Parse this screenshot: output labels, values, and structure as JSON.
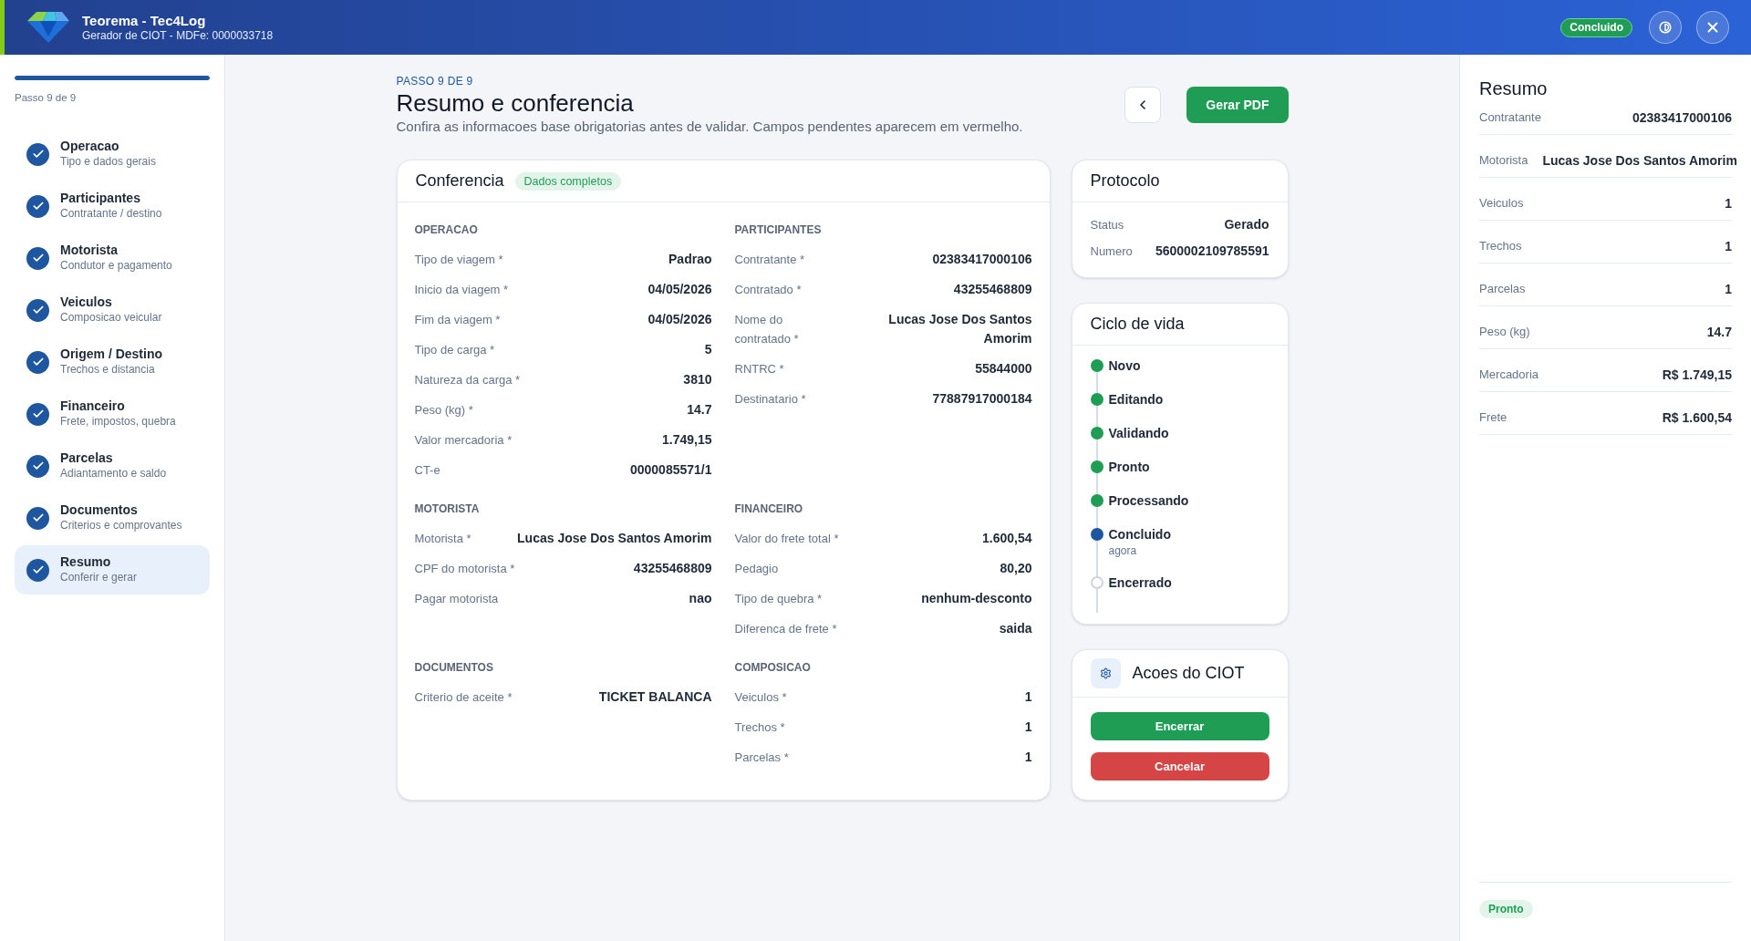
{
  "header": {
    "title": "Teorema - Tec4Log",
    "subtitle": "Gerador de CIOT - MDFe: 0000033718",
    "status": "Concluido"
  },
  "sidebar": {
    "progress": {
      "level": 1
    },
    "progress_label": "Passo 9 de 9",
    "steps": [
      {
        "title": "Operacao",
        "subtitle": "Tipo e dados gerais",
        "done": true,
        "selected": false
      },
      {
        "title": "Participantes",
        "subtitle": "Contratante / destino",
        "done": true,
        "selected": false
      },
      {
        "title": "Motorista",
        "subtitle": "Condutor e pagamento",
        "done": true,
        "selected": false
      },
      {
        "title": "Veiculos",
        "subtitle": "Composicao veicular",
        "done": true,
        "selected": false
      },
      {
        "title": "Origem / Destino",
        "subtitle": "Trechos e distancia",
        "done": true,
        "selected": false
      },
      {
        "title": "Financeiro",
        "subtitle": "Frete, impostos, quebra",
        "done": true,
        "selected": false
      },
      {
        "title": "Parcelas",
        "subtitle": "Adiantamento e saldo",
        "done": true,
        "selected": false
      },
      {
        "title": "Documentos",
        "subtitle": "Criterios e comprovantes",
        "done": true,
        "selected": false
      },
      {
        "title": "Resumo",
        "subtitle": "Conferir e gerar",
        "done": true,
        "selected": true
      }
    ]
  },
  "page": {
    "eyebrow": "PASSO 9 DE 9",
    "title": "Resumo e conferencia",
    "description": "Confira as informacoes base obrigatorias antes de validar. Campos pendentes aparecem em vermelho.",
    "primary_button": "Gerar PDF"
  },
  "conferencia": {
    "title": "Conferencia",
    "badge": "Dados completos",
    "sections": [
      {
        "title": "OPERACAO",
        "rows": [
          {
            "label": "Tipo de viagem *",
            "value": "Padrao"
          },
          {
            "label": "Inicio da viagem *",
            "value": "04/05/2026"
          },
          {
            "label": "Fim da viagem *",
            "value": "04/05/2026"
          },
          {
            "label": "Tipo de carga *",
            "value": "5"
          },
          {
            "label": "Natureza da carga *",
            "value": "3810"
          },
          {
            "label": "Peso (kg) *",
            "value": "14.7"
          },
          {
            "label": "Valor mercadoria *",
            "value": "1.749,15"
          },
          {
            "label": "CT-e",
            "value": "0000085571/1"
          }
        ]
      },
      {
        "title": "PARTICIPANTES",
        "rows": [
          {
            "label": "Contratante *",
            "value": "02383417000106"
          },
          {
            "label": "Contratado *",
            "value": "43255468809"
          },
          {
            "label": "Nome do contratado *",
            "value": "Lucas Jose Dos Santos Amorim"
          },
          {
            "label": "RNTRC *",
            "value": "55844000"
          },
          {
            "label": "Destinatario *",
            "value": "77887917000184"
          }
        ]
      },
      {
        "title": "MOTORISTA",
        "rows": [
          {
            "label": "Motorista *",
            "value": "Lucas Jose Dos Santos Amorim"
          },
          {
            "label": "CPF do motorista *",
            "value": "43255468809"
          },
          {
            "label": "Pagar motorista",
            "value": "nao"
          }
        ]
      },
      {
        "title": "FINANCEIRO",
        "rows": [
          {
            "label": "Valor do frete total *",
            "value": "1.600,54"
          },
          {
            "label": "Pedagio",
            "value": "80,20"
          },
          {
            "label": "Tipo de quebra *",
            "value": "nenhum-desconto"
          },
          {
            "label": "Diferenca de frete *",
            "value": "saida"
          }
        ]
      },
      {
        "title": "DOCUMENTOS",
        "rows": [
          {
            "label": "Criterio de aceite *",
            "value": "TICKET BALANCA"
          }
        ]
      },
      {
        "title": "COMPOSICAO",
        "rows": [
          {
            "label": "Veiculos *",
            "value": "1"
          },
          {
            "label": "Trechos *",
            "value": "1"
          },
          {
            "label": "Parcelas *",
            "value": "1"
          }
        ]
      }
    ]
  },
  "protocolo": {
    "title": "Protocolo",
    "rows": [
      {
        "label": "Status",
        "value": "Gerado"
      },
      {
        "label": "Numero",
        "value": "5600002109785591"
      }
    ]
  },
  "lifecycle": {
    "title": "Ciclo de vida",
    "items": [
      {
        "label": "Novo",
        "done": true,
        "current": false
      },
      {
        "label": "Editando",
        "done": true,
        "current": false
      },
      {
        "label": "Validando",
        "done": true,
        "current": false
      },
      {
        "label": "Pronto",
        "done": true,
        "current": false
      },
      {
        "label": "Processando",
        "done": true,
        "current": false
      },
      {
        "label": "Concluido",
        "done": false,
        "current": true,
        "time": "agora"
      },
      {
        "label": "Encerrado",
        "done": false,
        "current": false
      }
    ]
  },
  "actions": {
    "title": "Acoes do CIOT",
    "buttons": [
      {
        "label": "Encerrar",
        "kind": "success"
      },
      {
        "label": "Cancelar",
        "kind": "danger"
      }
    ]
  },
  "summary": {
    "title": "Resumo",
    "rows": [
      {
        "label": "Contratante",
        "value": "02383417000106"
      },
      {
        "label": "Motorista",
        "value": "Lucas Jose Dos Santos Amorim"
      },
      {
        "label": "Veiculos",
        "value": "1"
      },
      {
        "label": "Trechos",
        "value": "1"
      },
      {
        "label": "Parcelas",
        "value": "1"
      },
      {
        "label": "Peso (kg)",
        "value": "14.7"
      },
      {
        "label": "Mercadoria",
        "value": "R$ 1.749,15"
      },
      {
        "label": "Frete",
        "value": "R$ 1.600,54"
      }
    ],
    "status": "Pronto"
  }
}
